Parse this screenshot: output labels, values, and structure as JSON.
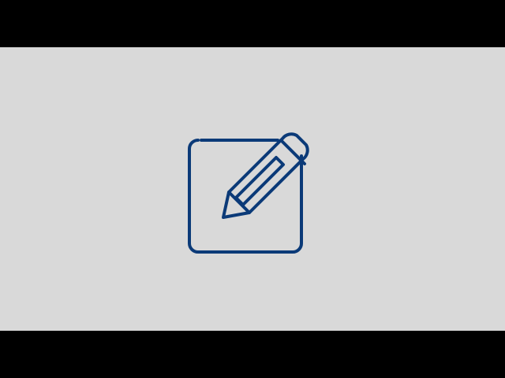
{
  "scene": {
    "background_color": "#d9d9d9",
    "letterbox_color": "#000000"
  },
  "icon": {
    "name": "edit-icon",
    "stroke_color": "#0b3a78",
    "fill_color": "none"
  }
}
